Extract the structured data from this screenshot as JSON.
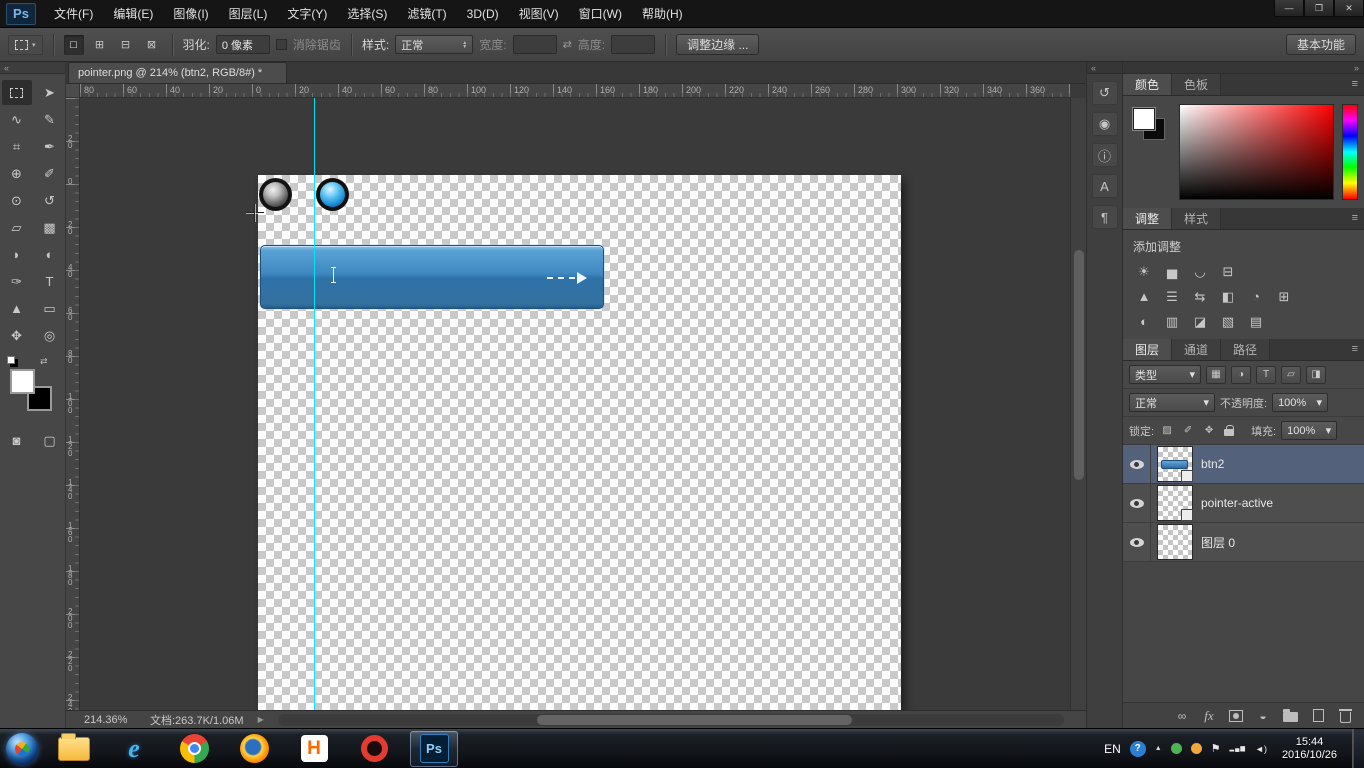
{
  "colors": {
    "guide": "#00e8ff",
    "button_blue_top": "#6fb0de",
    "button_blue_bottom": "#2e6da5",
    "selected_layer_bg": "#53617a"
  },
  "menu": {
    "logo": "Ps",
    "items": [
      "文件(F)",
      "编辑(E)",
      "图像(I)",
      "图层(L)",
      "文字(Y)",
      "选择(S)",
      "滤镜(T)",
      "3D(D)",
      "视图(V)",
      "窗口(W)",
      "帮助(H)"
    ]
  },
  "icons": {
    "minimize": "—",
    "restore": "❐",
    "close": "✕",
    "dropdown": "▾",
    "spin_up": "▲",
    "spin_down": "▼",
    "swap": "⇄",
    "collapse_left": "«",
    "collapse_right": "»",
    "panel_menu": "≡",
    "quick_mask": "◙",
    "screen_mode": "▢",
    "play": "▶",
    "link": "∞",
    "fx": "fx",
    "adjustment": "◒",
    "ie": "e",
    "hbuilder": "H",
    "ps": "Ps",
    "tray_arrow": "▲",
    "tray_flag": "⚑",
    "tray_net": "▂▄▆",
    "tray_vol": "◄)"
  },
  "options": {
    "modes": [
      "□",
      "⊞",
      "⊟",
      "⊠"
    ],
    "feather_label": "羽化:",
    "feather_value": "0 像素",
    "antialias": "消除锯齿",
    "style_label": "样式:",
    "style_value": "正常",
    "width_label": "宽度:",
    "width_value": "",
    "height_label": "高度:",
    "height_value": "",
    "refine_edge": "调整边缘 ...",
    "workspace": "基本功能"
  },
  "doc": {
    "tab": "pointer.png @ 214% (btn2, RGB/8#) *"
  },
  "rulers": {
    "top": [
      "80",
      "60",
      "40",
      "20",
      "0",
      "20",
      "40",
      "60",
      "80",
      "100",
      "120",
      "140",
      "160",
      "180",
      "200",
      "220",
      "240",
      "260",
      "280",
      "300",
      "320",
      "340",
      "360"
    ],
    "left": [
      "20",
      "0",
      "20",
      "40",
      "60",
      "80",
      "100",
      "120",
      "140",
      "160",
      "180",
      "200",
      "220",
      "240"
    ]
  },
  "tools": [
    {
      "name": "rectangular-marquee-tool",
      "glyph": "",
      "selected": true
    },
    {
      "name": "move-tool",
      "glyph": "➤"
    },
    {
      "name": "lasso-tool",
      "glyph": "∿"
    },
    {
      "name": "quick-selection-tool",
      "glyph": "✎"
    },
    {
      "name": "crop-tool",
      "glyph": "⌗"
    },
    {
      "name": "eyedropper-tool",
      "glyph": "✒"
    },
    {
      "name": "spot-healing-brush-tool",
      "glyph": "⊕"
    },
    {
      "name": "brush-tool",
      "glyph": "✐"
    },
    {
      "name": "clone-stamp-tool",
      "glyph": "⊙"
    },
    {
      "name": "history-brush-tool",
      "glyph": "↺"
    },
    {
      "name": "eraser-tool",
      "glyph": "▱"
    },
    {
      "name": "gradient-tool",
      "glyph": "▩"
    },
    {
      "name": "blur-tool",
      "glyph": "◗"
    },
    {
      "name": "dodge-tool",
      "glyph": "◐"
    },
    {
      "name": "pen-tool",
      "glyph": "✑"
    },
    {
      "name": "type-tool",
      "glyph": "T"
    },
    {
      "name": "path-selection-tool",
      "glyph": "▲"
    },
    {
      "name": "rectangle-tool",
      "glyph": "▭"
    },
    {
      "name": "hand-tool",
      "glyph": "✥"
    },
    {
      "name": "zoom-tool",
      "glyph": "◎"
    }
  ],
  "strip": [
    {
      "name": "history-panel-icon",
      "glyph": "↺"
    },
    {
      "name": "properties-panel-icon",
      "glyph": "◉"
    },
    {
      "name": "info-panel-icon",
      "glyph": "ⓘ"
    },
    {
      "name": "character-panel-icon",
      "glyph": "A"
    },
    {
      "name": "paragraph-panel-icon",
      "glyph": "¶"
    }
  ],
  "panels": {
    "color": {
      "tabs": [
        "颜色",
        "色板"
      ]
    },
    "adjust": {
      "tabs": [
        "调整",
        "样式"
      ],
      "add": "添加调整"
    },
    "adjust_icons": [
      [
        "☀",
        "▅",
        "◡",
        "⊟"
      ],
      [
        "▲",
        "☰",
        "⇆",
        "◧",
        "◔",
        "⊞"
      ],
      [
        "◐",
        "▥",
        "◪",
        "▧",
        "▤"
      ]
    ],
    "layers": {
      "tabs": [
        "图层",
        "通道",
        "路径"
      ],
      "filter_label": "类型",
      "filter_icons": [
        "▦",
        "◑",
        "T",
        "▱",
        "◨"
      ],
      "blend": "正常",
      "opacity_label": "不透明度:",
      "opacity_value": "100%",
      "lock_label": "锁定:",
      "lock_icons": [
        "▨",
        "✐",
        "✥"
      ],
      "fill_label": "填充:",
      "fill_value": "100%",
      "items": [
        {
          "name": "btn2",
          "selected": true
        },
        {
          "name": "pointer-active",
          "selected": false
        },
        {
          "name": "图层 0",
          "selected": false
        }
      ]
    }
  },
  "status": {
    "zoom": "214.36%",
    "docsize": "文档:263.7K/1.06M"
  },
  "taskbar": {
    "lang": "EN",
    "help": "?",
    "time": "15:44",
    "date": "2016/10/26"
  }
}
